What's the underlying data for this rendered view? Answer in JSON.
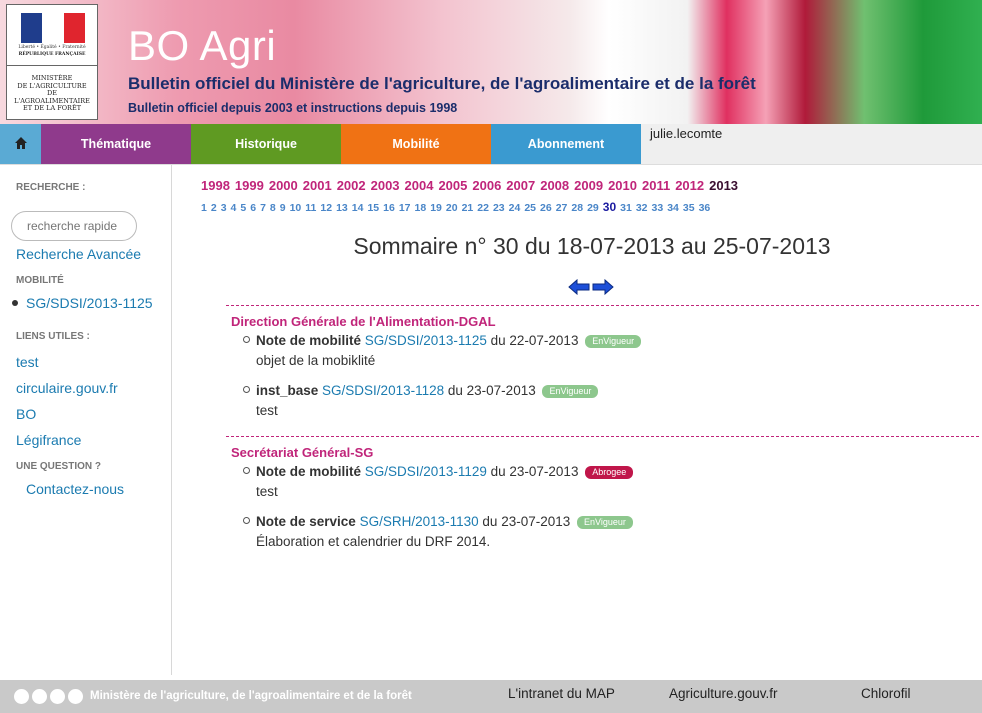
{
  "header": {
    "logo": {
      "motto": "Liberté • Égalité • Fraternité",
      "republic": "RÉPUBLIQUE FRANÇAISE",
      "ministry_lines": [
        "MINISTÈRE",
        "DE L'AGRICULTURE",
        "DE L'AGROALIMENTAIRE",
        "ET DE LA FORÊT"
      ]
    },
    "title": "BO Agri",
    "subtitle": "Bulletin officiel du Ministère de l'agriculture, de l'agroalimentaire et de la forêt",
    "tagline": "Bulletin officiel depuis 2003 et instructions depuis 1998"
  },
  "nav": {
    "home_icon": "home-icon",
    "items": [
      {
        "label": "Thématique",
        "color": "#8f3a8c"
      },
      {
        "label": "Historique",
        "color": "#5f9a22"
      },
      {
        "label": "Mobilité",
        "color": "#f07214"
      },
      {
        "label": "Abonnement",
        "color": "#3a9ad0"
      }
    ],
    "user": "julie.lecomte"
  },
  "sidebar": {
    "search_label": "RECHERCHE :",
    "search_placeholder": "recherche rapide",
    "advanced_search": "Recherche Avancée",
    "mobility_label": "MOBILITÉ",
    "mobility_item": "SG/SDSI/2013-1125",
    "links_label": "LIENS UTILES :",
    "links": [
      "test",
      "circulaire.gouv.fr",
      "BO",
      "Légifrance"
    ],
    "question_label": "UNE QUESTION ?",
    "contact": "Contactez-nous"
  },
  "main": {
    "years": [
      "1998",
      "1999",
      "2000",
      "2001",
      "2002",
      "2003",
      "2004",
      "2005",
      "2006",
      "2007",
      "2008",
      "2009",
      "2010",
      "2011",
      "2012",
      "2013"
    ],
    "current_year": "2013",
    "weeks": [
      "1",
      "2",
      "3",
      "4",
      "5",
      "6",
      "7",
      "8",
      "9",
      "10",
      "11",
      "12",
      "13",
      "14",
      "15",
      "16",
      "17",
      "18",
      "19",
      "20",
      "21",
      "22",
      "23",
      "24",
      "25",
      "26",
      "27",
      "28",
      "29",
      "30",
      "31",
      "32",
      "33",
      "34",
      "35",
      "36"
    ],
    "current_week": "30",
    "sommaire_title": "Sommaire n° 30 du 18-07-2013 au 25-07-2013",
    "sections": [
      {
        "title": "Direction Générale de l'Alimentation-DGAL",
        "entries": [
          {
            "type": "Note de mobilité",
            "ref": "SG/SDSI/2013-1125",
            "date": "du 22-07-2013",
            "badge": "EnVigueur",
            "badge_color": "#8dc78d",
            "desc": "objet de la mobiklité"
          },
          {
            "type": "inst_base",
            "ref": "SG/SDSI/2013-1128",
            "date": "du 23-07-2013",
            "badge": "EnVigueur",
            "badge_color": "#8dc78d",
            "desc": "test"
          }
        ]
      },
      {
        "title": "Secrétariat Général-SG",
        "entries": [
          {
            "type": "Note de mobilité",
            "ref": "SG/SDSI/2013-1129",
            "date": "du 23-07-2013",
            "badge": "Abrogee",
            "badge_color": "#c0164a",
            "desc": "test"
          },
          {
            "type": "Note de service",
            "ref": "SG/SRH/2013-1130",
            "date": "du 23-07-2013",
            "badge": "EnVigueur",
            "badge_color": "#8dc78d",
            "desc": "Élaboration et calendrier du DRF 2014."
          }
        ]
      }
    ]
  },
  "footer": {
    "ministry": "Ministère de l'agriculture, de l'agroalimentaire et de la forêt",
    "links": [
      "L'intranet du MAP",
      "Agriculture.gouv.fr",
      "Chlorofil"
    ]
  }
}
